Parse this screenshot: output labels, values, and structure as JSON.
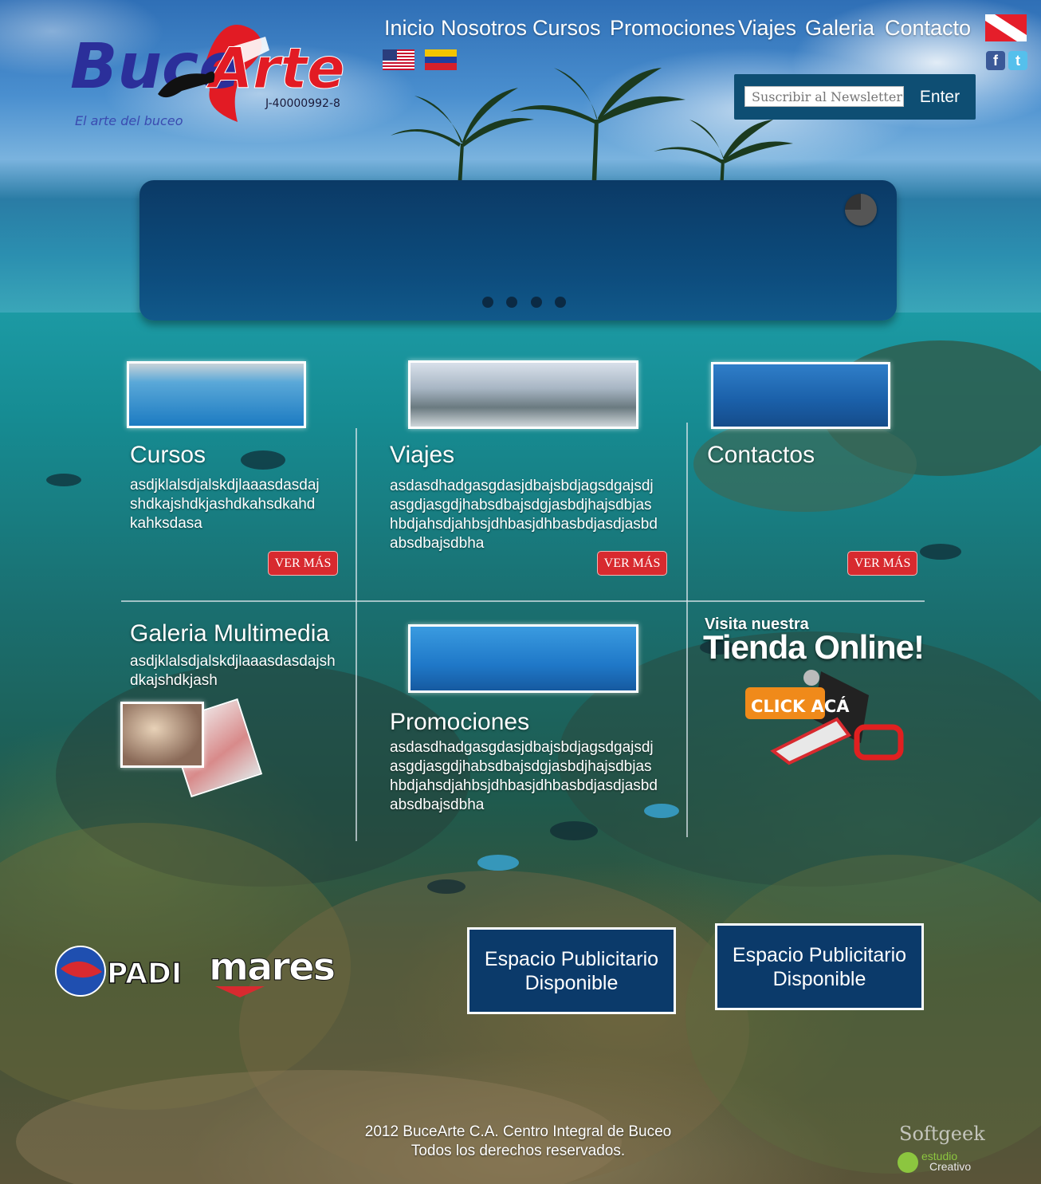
{
  "brand": {
    "logo_word1": "Buce",
    "logo_word2": "Arte",
    "rif": "J-40000992-8",
    "slogan": "El arte del buceo"
  },
  "nav": {
    "items": [
      "Inicio",
      "Nosotros",
      "Cursos",
      "Promociones",
      "Viajes",
      "Galeria",
      "Contacto"
    ]
  },
  "languages": [
    "en-us-flag",
    "es-ve-flag"
  ],
  "social": [
    "facebook-icon",
    "twitter-icon"
  ],
  "newsletter": {
    "placeholder": "Suscribir al Newsletter",
    "button": "Enter"
  },
  "slider": {
    "dots": 4
  },
  "sections": {
    "cursos": {
      "title": "Cursos",
      "text": "asdjklalsdjalskdjlaaasdasdajshdkajshdkjashdkahsdkahdkahksdasa",
      "button": "VER MÁS"
    },
    "viajes": {
      "title": "Viajes",
      "text": "asdasdhadgasgdasjdbajsbdjagsdgajsdjasgdjasgdjhabsdbajsdgjasbdjhajsdbjashbdjahsdjahbsjdhbasjdhbasbdjasdjasbdabsdbajsdbha",
      "button": "VER MÁS"
    },
    "contactos": {
      "title": "Contactos",
      "button": "VER MÁS"
    },
    "galeria": {
      "title": "Galeria Multimedia",
      "text": "asdjklalsdjalskdjlaaasdasdajshdkajshdkjash"
    },
    "promociones": {
      "title": "Promociones",
      "text": "asdasdhadgasgdasjdbajsbdjagsdgajsdjasgdjasgdjhabsdbajsdgjasbdjhajsdbjashbdjahsdjahbsjdhbasjdhbasbdjasdjasbdabsdbajsdbha"
    },
    "tienda": {
      "visit": "Visita nuestra",
      "title": "Tienda Online!",
      "cta": "CLICK ACÁ"
    }
  },
  "partners": {
    "padi": "PADI",
    "mares": "mares"
  },
  "ads": [
    {
      "line1": "Espacio Publicitario",
      "line2": "Disponible"
    },
    {
      "line1": "Espacio Publicitario",
      "line2": "Disponible"
    }
  ],
  "footer": {
    "line1": "2012 BuceArte C.A.  Centro Integral de Buceo",
    "line2": "Todos los derechos reservados."
  },
  "credits": {
    "softgeek": "Softgeek",
    "estudio": "estudio",
    "creativo": "Creativo"
  },
  "colors": {
    "header_blue": "#0e4e73",
    "slider_blue": "#0b3a66",
    "button_red": "#d82a2f",
    "logo_blue": "#2b2f9a",
    "logo_red": "#e21b24"
  }
}
